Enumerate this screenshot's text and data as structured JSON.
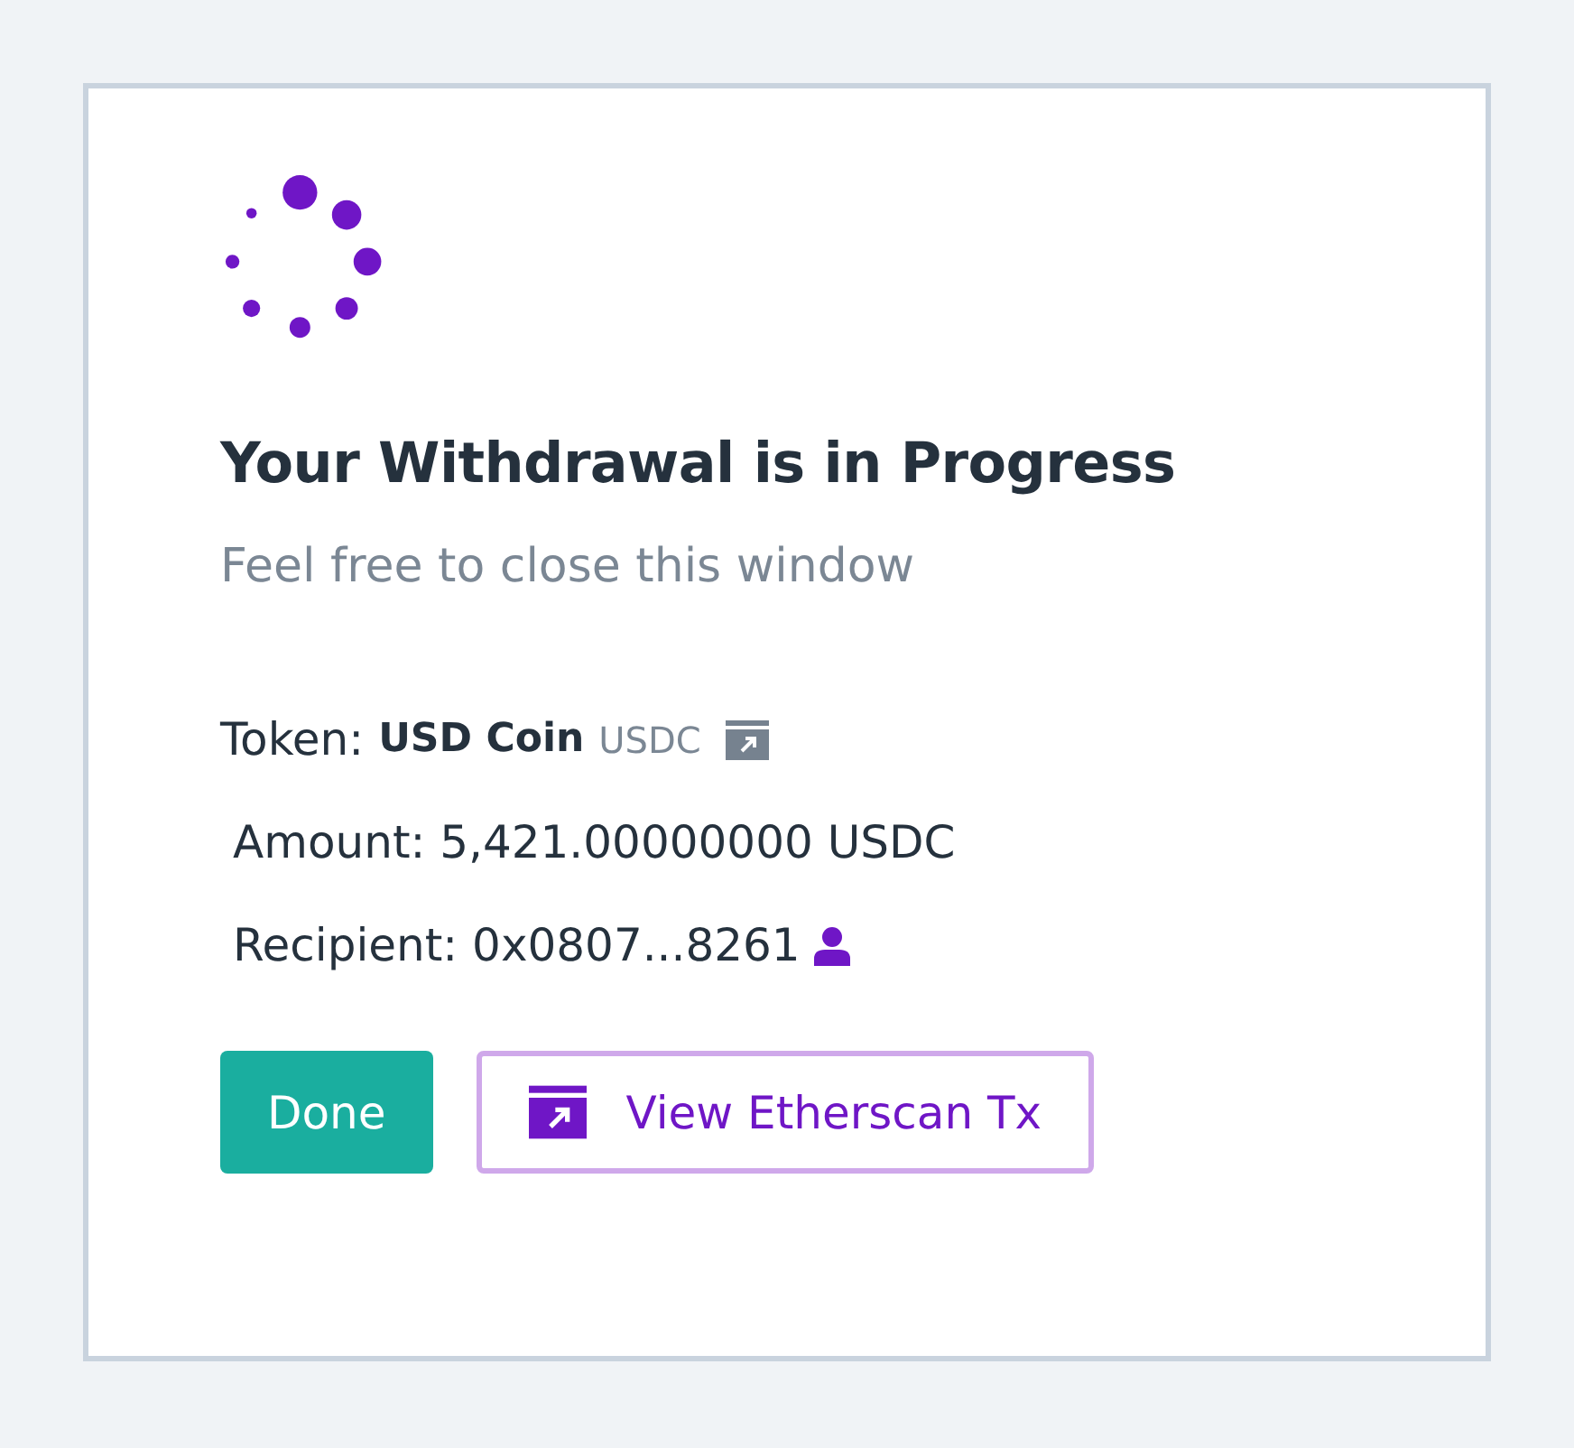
{
  "title": "Your Withdrawal is in Progress",
  "subtitle": "Feel free to close this window",
  "token": {
    "label": "Token:",
    "name": "USD Coin",
    "symbol": "USDC"
  },
  "amount": {
    "text": "Amount: 5,421.00000000 USDC"
  },
  "recipient": {
    "text": "Recipient: 0x0807...8261"
  },
  "buttons": [
    {
      "kind": "primary",
      "label": "Done"
    },
    {
      "kind": "outline",
      "label": "View Etherscan Tx"
    }
  ]
}
